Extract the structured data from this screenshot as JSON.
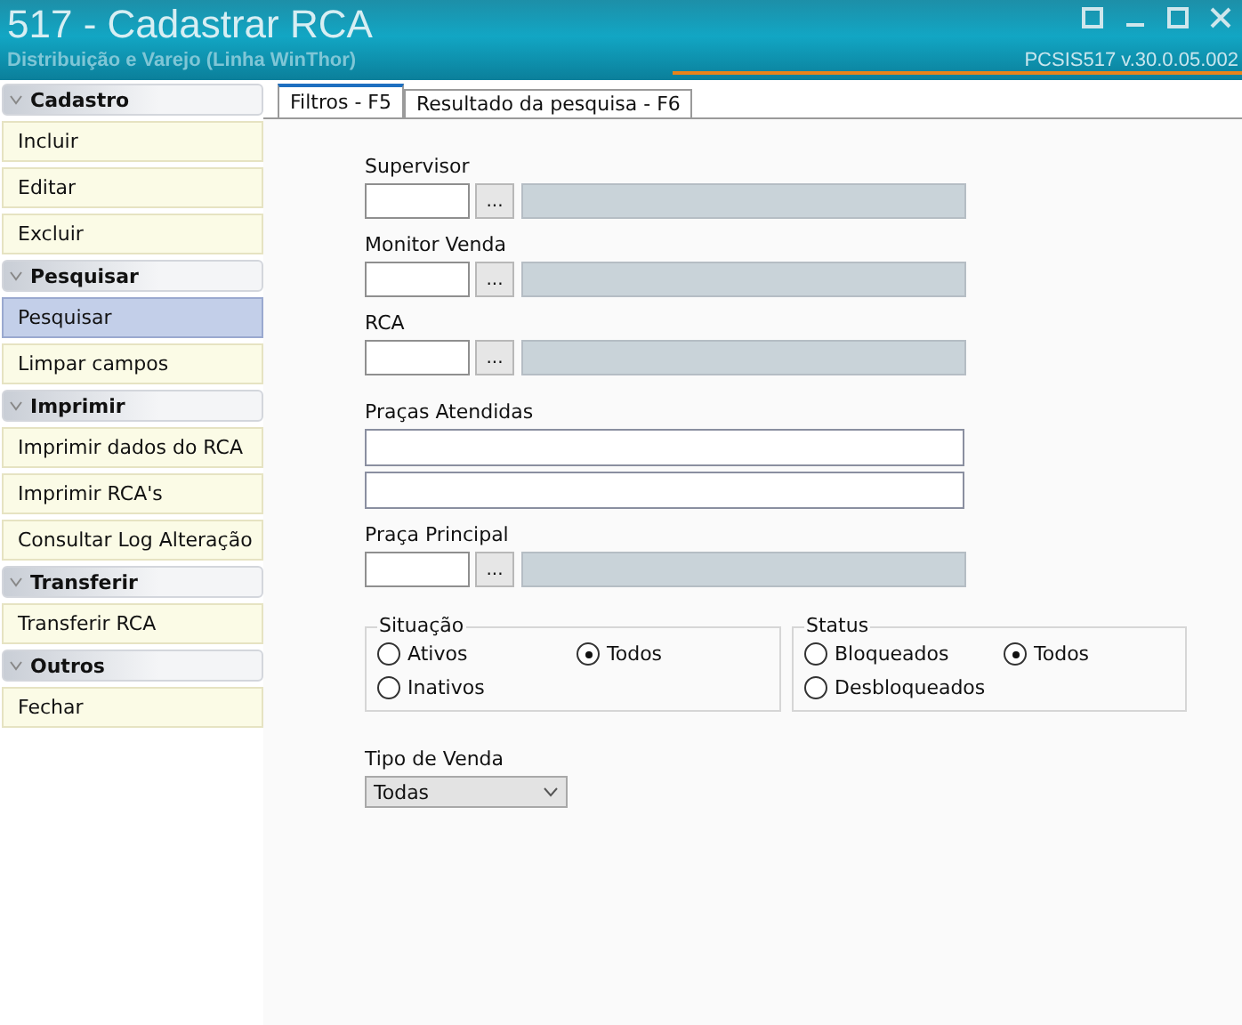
{
  "window": {
    "title": "517 - Cadastrar RCA",
    "subtitle": "Distribuição e Varejo (Linha WinThor)",
    "version": "PCSIS517  v.30.0.05.002"
  },
  "sidebar": {
    "sections": [
      {
        "title": "Cadastro",
        "items": [
          {
            "label": "Incluir",
            "selected": false
          },
          {
            "label": "Editar",
            "selected": false
          },
          {
            "label": "Excluir",
            "selected": false
          }
        ]
      },
      {
        "title": "Pesquisar",
        "items": [
          {
            "label": "Pesquisar",
            "selected": true
          },
          {
            "label": "Limpar campos",
            "selected": false
          }
        ]
      },
      {
        "title": "Imprimir",
        "items": [
          {
            "label": "Imprimir dados do RCA",
            "selected": false
          },
          {
            "label": "Imprimir RCA's",
            "selected": false
          },
          {
            "label": "Consultar Log Alteração",
            "selected": false
          }
        ]
      },
      {
        "title": "Transferir",
        "items": [
          {
            "label": "Transferir RCA",
            "selected": false
          }
        ]
      },
      {
        "title": "Outros",
        "items": [
          {
            "label": "Fechar",
            "selected": false
          }
        ]
      }
    ]
  },
  "tabs": [
    {
      "label": "Filtros - F5",
      "selected": true
    },
    {
      "label": "Resultado da pesquisa - F6",
      "selected": false
    }
  ],
  "filters": {
    "fields": [
      {
        "kind": "lookup",
        "label": "Supervisor"
      },
      {
        "kind": "lookup",
        "label": "Monitor Venda"
      },
      {
        "kind": "lookup",
        "label": "RCA"
      },
      {
        "kind": "list",
        "label": "Praças Atendidas"
      },
      {
        "kind": "lookup",
        "label": "Praça Principal"
      }
    ],
    "lookup_button": "...",
    "groups": [
      {
        "title": "Situação",
        "options": [
          {
            "label": "Ativos",
            "selected": false
          },
          {
            "label": "Todos",
            "selected": true
          },
          {
            "label": "Inativos",
            "selected": false
          }
        ]
      },
      {
        "title": "Status",
        "options": [
          {
            "label": "Bloqueados",
            "selected": false
          },
          {
            "label": "Todos",
            "selected": true
          },
          {
            "label": "Desbloqueados",
            "selected": false
          }
        ]
      }
    ],
    "sale_type": {
      "label": "Tipo de Venda",
      "value": "Todas"
    }
  }
}
